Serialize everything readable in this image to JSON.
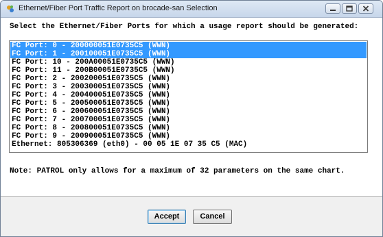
{
  "window": {
    "title": "Ethernet/Fiber Port Traffic Report on brocade-san Selection"
  },
  "instruction": "Select the Ethernet/Fiber Ports for which a usage report should be generated:",
  "ports": [
    {
      "label": "FC Port: 0 - 200000051E0735C5 (WWN)",
      "selected": true
    },
    {
      "label": "FC Port: 1 - 200100051E0735C5 (WWN)",
      "selected": true
    },
    {
      "label": "FC Port: 10 - 200A00051E0735C5 (WWN)",
      "selected": false
    },
    {
      "label": "FC Port: 11 - 200B00051E0735C5 (WWN)",
      "selected": false
    },
    {
      "label": "FC Port: 2 - 200200051E0735C5 (WWN)",
      "selected": false
    },
    {
      "label": "FC Port: 3 - 200300051E0735C5 (WWN)",
      "selected": false
    },
    {
      "label": "FC Port: 4 - 200400051E0735C5 (WWN)",
      "selected": false
    },
    {
      "label": "FC Port: 5 - 200500051E0735C5 (WWN)",
      "selected": false
    },
    {
      "label": "FC Port: 6 - 200600051E0735C5 (WWN)",
      "selected": false
    },
    {
      "label": "FC Port: 7 - 200700051E0735C5 (WWN)",
      "selected": false
    },
    {
      "label": "FC Port: 8 - 200800051E0735C5 (WWN)",
      "selected": false
    },
    {
      "label": "FC Port: 9 - 200900051E0735C5 (WWN)",
      "selected": false
    },
    {
      "label": "Ethernet: 805306369 (eth0) - 00 05 1E 07 35 C5 (MAC)",
      "selected": false
    }
  ],
  "note": "Note: PATROL only allows for a maximum of 32 parameters on the same chart.",
  "buttons": {
    "accept": "Accept",
    "cancel": "Cancel"
  },
  "colors": {
    "selection": "#3399ff",
    "titlebar": "#c7d6ea"
  }
}
